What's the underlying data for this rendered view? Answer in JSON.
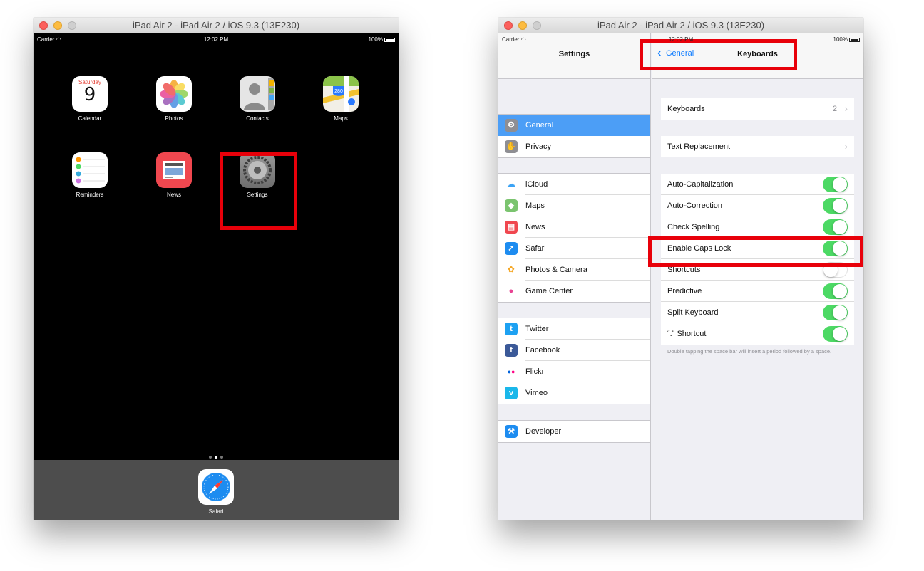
{
  "left_window": {
    "title": "iPad Air 2 - iPad Air 2 / iOS 9.3 (13E230)",
    "status": {
      "carrier": "Carrier",
      "time": "12:02 PM",
      "battery": "100%"
    },
    "apps": [
      {
        "label": "Calendar",
        "day_name": "Saturday",
        "day_number": "9"
      },
      {
        "label": "Photos"
      },
      {
        "label": "Contacts"
      },
      {
        "label": "Maps",
        "shield": "280"
      },
      {
        "label": "Reminders"
      },
      {
        "label": "News"
      },
      {
        "label": "Settings"
      }
    ],
    "dock": {
      "label": "Safari"
    }
  },
  "right_window": {
    "title": "iPad Air 2 - iPad Air 2 / iOS 9.3 (13E230)",
    "status": {
      "carrier": "Carrier",
      "time": "12:02 PM",
      "battery": "100%"
    },
    "master": {
      "title": "Settings",
      "groups": [
        [
          {
            "label": "General",
            "icon": "gear-icon",
            "color": "#8e8e93",
            "selected": true
          },
          {
            "label": "Privacy",
            "icon": "hand-icon",
            "color": "#8e8e93"
          }
        ],
        [
          {
            "label": "iCloud",
            "icon": "cloud-icon",
            "color": "#ffffff"
          },
          {
            "label": "Maps",
            "icon": "maps-icon",
            "color": "#7bc46f"
          },
          {
            "label": "News",
            "icon": "news-icon",
            "color": "#f0474f"
          },
          {
            "label": "Safari",
            "icon": "compass-icon",
            "color": "#1d8cf0"
          },
          {
            "label": "Photos & Camera",
            "icon": "flower-icon",
            "color": "#ffffff"
          },
          {
            "label": "Game Center",
            "icon": "bubbles-icon",
            "color": "#ffffff"
          }
        ],
        [
          {
            "label": "Twitter",
            "icon": "twitter-icon",
            "color": "#1da1f2"
          },
          {
            "label": "Facebook",
            "icon": "facebook-icon",
            "color": "#3b5998"
          },
          {
            "label": "Flickr",
            "icon": "flickr-icon",
            "color": "#ffffff"
          },
          {
            "label": "Vimeo",
            "icon": "vimeo-icon",
            "color": "#1ab7ea"
          }
        ],
        [
          {
            "label": "Developer",
            "icon": "hammer-icon",
            "color": "#1d8cf0"
          }
        ]
      ]
    },
    "detail": {
      "back_label": "General",
      "title": "Keyboards",
      "keyboards_row": {
        "label": "Keyboards",
        "value": "2"
      },
      "text_replacement_row": {
        "label": "Text Replacement"
      },
      "toggles": [
        {
          "label": "Auto-Capitalization",
          "on": true
        },
        {
          "label": "Auto-Correction",
          "on": true
        },
        {
          "label": "Check Spelling",
          "on": true
        },
        {
          "label": "Enable Caps Lock",
          "on": true
        },
        {
          "label": "Shortcuts",
          "on": false
        },
        {
          "label": "Predictive",
          "on": true
        },
        {
          "label": "Split Keyboard",
          "on": true
        },
        {
          "label": "“.” Shortcut",
          "on": true
        }
      ],
      "footnote": "Double tapping the space bar will insert a period followed by a space."
    }
  },
  "colors": {
    "highlight": "#e8000a",
    "toggle_on": "#4cd964",
    "selected_row": "#4c9ef6",
    "link": "#0a7aff"
  }
}
